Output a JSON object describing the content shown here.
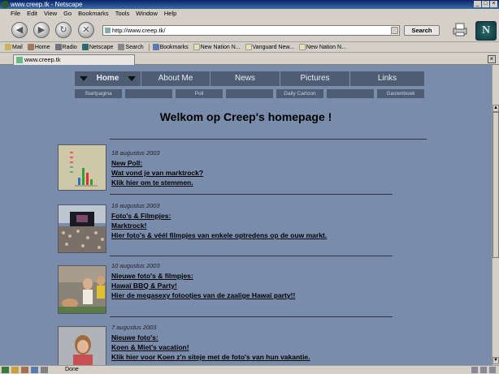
{
  "window": {
    "title": "www.creep.tk - Netscape"
  },
  "menu": [
    "File",
    "Edit",
    "View",
    "Go",
    "Bookmarks",
    "Tools",
    "Window",
    "Help"
  ],
  "toolbar": {
    "url": "http://www.creep.tk/",
    "search_label": "Search"
  },
  "personal_toolbar": [
    "Mail",
    "Home",
    "Radio",
    "Netscape",
    "Search",
    "Bookmarks",
    "New Nation N...",
    "Vanguard New...",
    "New Nation N..."
  ],
  "tab": {
    "label": "www.creep.tk"
  },
  "site": {
    "nav": [
      "Home",
      "About Me",
      "News",
      "Pictures",
      "Links"
    ],
    "subnav": [
      "Startpagina",
      "",
      "Poll",
      "",
      "Daily Cartoon",
      "",
      "Gastenboek"
    ],
    "headline": "Welkom op Creep's homepage !",
    "entries": [
      {
        "date": "18 augustus 2003",
        "title": "New Poll:",
        "line2": "Wat vond je van marktrock?",
        "line3": "Klik hier om te stemmen."
      },
      {
        "date": "16 augustus 2003",
        "title": "Foto's & Filmpjes:",
        "line2": "Marktrock!",
        "line3": "Hier foto's & véél filmpjes van enkele optredens op de ouw markt."
      },
      {
        "date": "10 augustus 2003",
        "title": "Nieuwe foto's & filmpjes:",
        "line2": "Hawaï BBQ & Party!",
        "line3": "Hier de megasexy fotootjes van de zaalige Hawaï party!!"
      },
      {
        "date": "7 augustus 2003",
        "title": "Nieuwe foto's:",
        "line2": "Koen & Miet's vacation!",
        "line3": "Klik hier voor Koen z'n siteje met de foto's van hun vakantie."
      }
    ]
  },
  "status": {
    "text": "Done"
  }
}
